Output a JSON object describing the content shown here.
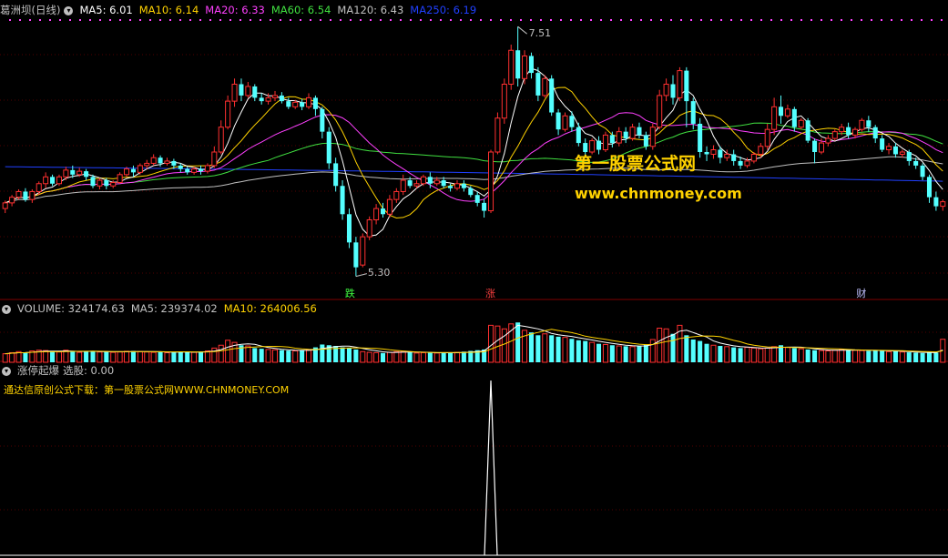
{
  "header": {
    "stock_title": "葛洲坝(日线)",
    "ma_items": [
      {
        "label": "MA5: 6.01",
        "color": "#ffffff"
      },
      {
        "label": "MA10: 6.14",
        "color": "#ffd200"
      },
      {
        "label": "MA20: 6.33",
        "color": "#ff40ff"
      },
      {
        "label": "MA60: 6.54",
        "color": "#40e040"
      },
      {
        "label": "MA120: 6.43",
        "color": "#c0c0c0"
      },
      {
        "label": "MA250: 6.19",
        "color": "#2040ff"
      }
    ]
  },
  "volume_header": {
    "items": [
      {
        "label": "VOLUME: 324174.63",
        "color": "#c0c0c0"
      },
      {
        "label": "MA5: 239374.02",
        "color": "#c0c0c0"
      },
      {
        "label": "MA10: 264006.56",
        "color": "#ffd200"
      }
    ]
  },
  "indicator_header": {
    "name": "涨停起爆",
    "select_label": "选股: 0.00",
    "note": "通达信原创公式下载：第一股票公式网WWW.CHNMONEY.COM"
  },
  "watermark": {
    "line1": "第一股票公式网",
    "line2": "www.chnmoney.com"
  },
  "annotations": {
    "high_label": "7.51",
    "low_label": "5.30",
    "tag_down": "跌",
    "tag_up": "涨",
    "tag_fin": "财"
  },
  "colors": {
    "up": "#ff3030",
    "down": "#54ffff",
    "ma5": "#ffffff",
    "ma10": "#ffd200",
    "ma20": "#ff40ff",
    "ma60": "#40e040",
    "ma120": "#c0c0c0",
    "ma250": "#2040ff",
    "grid": "#800000"
  },
  "chart_data": {
    "type": "candlestick",
    "price_ylim": [
      5.2,
      7.6
    ],
    "candles": [
      [
        5.9,
        5.95,
        5.86,
        5.97
      ],
      [
        5.95,
        6.0,
        5.92,
        6.02
      ],
      [
        6.0,
        6.05,
        5.98,
        6.07
      ],
      [
        6.05,
        5.98,
        5.96,
        6.08
      ],
      [
        5.98,
        6.05,
        5.95,
        6.07
      ],
      [
        6.05,
        6.12,
        6.02,
        6.14
      ],
      [
        6.12,
        6.18,
        6.08,
        6.22
      ],
      [
        6.18,
        6.12,
        6.1,
        6.2
      ],
      [
        6.12,
        6.18,
        6.1,
        6.2
      ],
      [
        6.18,
        6.24,
        6.15,
        6.27
      ],
      [
        6.24,
        6.2,
        6.17,
        6.28
      ],
      [
        6.2,
        6.23,
        6.18,
        6.26
      ],
      [
        6.23,
        6.18,
        6.15,
        6.25
      ],
      [
        6.18,
        6.1,
        6.08,
        6.2
      ],
      [
        6.1,
        6.15,
        6.07,
        6.17
      ],
      [
        6.15,
        6.1,
        6.07,
        6.17
      ],
      [
        6.1,
        6.13,
        6.08,
        6.15
      ],
      [
        6.13,
        6.2,
        6.12,
        6.22
      ],
      [
        6.2,
        6.25,
        6.18,
        6.27
      ],
      [
        6.25,
        6.22,
        6.18,
        6.28
      ],
      [
        6.22,
        6.28,
        6.2,
        6.3
      ],
      [
        6.28,
        6.3,
        6.25,
        6.33
      ],
      [
        6.3,
        6.35,
        6.28,
        6.38
      ],
      [
        6.35,
        6.3,
        6.27,
        6.37
      ],
      [
        6.3,
        6.32,
        6.28,
        6.35
      ],
      [
        6.32,
        6.28,
        6.25,
        6.34
      ],
      [
        6.28,
        6.25,
        6.22,
        6.3
      ],
      [
        6.25,
        6.22,
        6.2,
        6.27
      ],
      [
        6.22,
        6.25,
        6.2,
        6.27
      ],
      [
        6.25,
        6.23,
        6.2,
        6.28
      ],
      [
        6.23,
        6.28,
        6.21,
        6.3
      ],
      [
        6.28,
        6.4,
        6.26,
        6.45
      ],
      [
        6.4,
        6.62,
        6.38,
        6.68
      ],
      [
        6.62,
        6.85,
        6.6,
        6.9
      ],
      [
        6.85,
        7.0,
        6.8,
        7.05
      ],
      [
        7.0,
        6.9,
        6.85,
        7.05
      ],
      [
        6.9,
        6.98,
        6.88,
        7.02
      ],
      [
        6.98,
        6.88,
        6.85,
        7.0
      ],
      [
        6.88,
        6.85,
        6.82,
        6.92
      ],
      [
        6.85,
        6.88,
        6.82,
        6.92
      ],
      [
        6.88,
        6.9,
        6.85,
        6.94
      ],
      [
        6.9,
        6.85,
        6.83,
        6.93
      ],
      [
        6.85,
        6.8,
        6.78,
        6.88
      ],
      [
        6.8,
        6.84,
        6.78,
        6.86
      ],
      [
        6.84,
        6.8,
        6.77,
        6.87
      ],
      [
        6.8,
        6.88,
        6.78,
        6.92
      ],
      [
        6.88,
        6.78,
        6.72,
        6.9
      ],
      [
        6.78,
        6.58,
        6.52,
        6.8
      ],
      [
        6.58,
        6.3,
        6.25,
        6.62
      ],
      [
        6.3,
        6.1,
        6.05,
        6.35
      ],
      [
        6.1,
        5.85,
        5.8,
        6.15
      ],
      [
        5.85,
        5.6,
        5.55,
        5.9
      ],
      [
        5.6,
        5.38,
        5.3,
        5.65
      ],
      [
        5.4,
        5.65,
        5.38,
        5.68
      ],
      [
        5.65,
        5.8,
        5.62,
        5.83
      ],
      [
        5.8,
        5.9,
        5.76,
        5.94
      ],
      [
        5.9,
        5.85,
        5.82,
        5.95
      ],
      [
        5.85,
        5.98,
        5.82,
        6.02
      ],
      [
        5.98,
        6.05,
        5.95,
        6.08
      ],
      [
        6.05,
        6.15,
        6.02,
        6.2
      ],
      [
        6.15,
        6.1,
        6.08,
        6.18
      ],
      [
        6.1,
        6.12,
        6.08,
        6.15
      ],
      [
        6.12,
        6.18,
        6.1,
        6.2
      ],
      [
        6.18,
        6.12,
        6.08,
        6.22
      ],
      [
        6.12,
        6.15,
        6.1,
        6.18
      ],
      [
        6.15,
        6.1,
        6.08,
        6.18
      ],
      [
        6.1,
        6.08,
        6.05,
        6.12
      ],
      [
        6.08,
        6.12,
        6.06,
        6.15
      ],
      [
        6.12,
        6.08,
        6.05,
        6.15
      ],
      [
        6.08,
        6.02,
        6.0,
        6.1
      ],
      [
        6.02,
        5.95,
        5.92,
        6.05
      ],
      [
        5.95,
        5.88,
        5.82,
        5.98
      ],
      [
        5.88,
        6.4,
        5.86,
        6.42
      ],
      [
        6.4,
        6.7,
        6.38,
        6.75
      ],
      [
        6.7,
        7.0,
        6.65,
        7.05
      ],
      [
        7.0,
        7.3,
        6.95,
        7.35
      ],
      [
        7.3,
        7.05,
        6.98,
        7.51
      ],
      [
        7.05,
        7.25,
        7.0,
        7.3
      ],
      [
        7.25,
        7.1,
        7.05,
        7.28
      ],
      [
        7.1,
        6.9,
        6.85,
        7.15
      ],
      [
        6.9,
        7.05,
        6.88,
        7.08
      ],
      [
        7.05,
        6.75,
        6.72,
        7.08
      ],
      [
        6.75,
        6.6,
        6.55,
        6.78
      ],
      [
        6.6,
        6.72,
        6.58,
        6.75
      ],
      [
        6.72,
        6.62,
        6.58,
        6.76
      ],
      [
        6.62,
        6.48,
        6.45,
        6.66
      ],
      [
        6.48,
        6.4,
        6.35,
        6.52
      ],
      [
        6.4,
        6.5,
        6.38,
        6.52
      ],
      [
        6.5,
        6.42,
        6.38,
        6.54
      ],
      [
        6.42,
        6.55,
        6.4,
        6.58
      ],
      [
        6.55,
        6.48,
        6.44,
        6.58
      ],
      [
        6.48,
        6.58,
        6.45,
        6.62
      ],
      [
        6.58,
        6.52,
        6.48,
        6.62
      ],
      [
        6.52,
        6.62,
        6.5,
        6.65
      ],
      [
        6.62,
        6.55,
        6.52,
        6.66
      ],
      [
        6.55,
        6.45,
        6.42,
        6.58
      ],
      [
        6.45,
        6.62,
        6.42,
        6.65
      ],
      [
        6.62,
        6.9,
        6.6,
        6.95
      ],
      [
        6.9,
        7.0,
        6.85,
        7.05
      ],
      [
        7.0,
        6.88,
        6.82,
        7.08
      ],
      [
        6.88,
        7.12,
        6.85,
        7.15
      ],
      [
        7.12,
        6.85,
        6.62,
        7.15
      ],
      [
        6.85,
        6.65,
        6.6,
        6.88
      ],
      [
        6.65,
        6.4,
        6.35,
        6.7
      ],
      [
        6.4,
        6.38,
        6.32,
        6.45
      ],
      [
        6.38,
        6.42,
        6.34,
        6.46
      ],
      [
        6.42,
        6.35,
        6.3,
        6.45
      ],
      [
        6.35,
        6.38,
        6.32,
        6.42
      ],
      [
        6.38,
        6.32,
        6.28,
        6.42
      ],
      [
        6.32,
        6.28,
        6.25,
        6.36
      ],
      [
        6.28,
        6.32,
        6.26,
        6.35
      ],
      [
        6.32,
        6.38,
        6.3,
        6.4
      ],
      [
        6.38,
        6.45,
        6.35,
        6.48
      ],
      [
        6.45,
        6.6,
        6.42,
        6.65
      ],
      [
        6.6,
        6.8,
        6.55,
        6.88
      ],
      [
        6.8,
        6.72,
        6.65,
        6.9
      ],
      [
        6.72,
        6.78,
        6.7,
        6.82
      ],
      [
        6.78,
        6.62,
        6.58,
        6.8
      ],
      [
        6.62,
        6.68,
        6.6,
        6.7
      ],
      [
        6.68,
        6.5,
        6.48,
        6.7
      ],
      [
        6.5,
        6.4,
        6.3,
        6.52
      ],
      [
        6.4,
        6.48,
        6.38,
        6.52
      ],
      [
        6.48,
        6.52,
        6.45,
        6.55
      ],
      [
        6.52,
        6.58,
        6.5,
        6.6
      ],
      [
        6.58,
        6.62,
        6.55,
        6.65
      ],
      [
        6.62,
        6.55,
        6.52,
        6.66
      ],
      [
        6.55,
        6.6,
        6.52,
        6.62
      ],
      [
        6.6,
        6.68,
        6.58,
        6.7
      ],
      [
        6.68,
        6.62,
        6.58,
        6.72
      ],
      [
        6.62,
        6.52,
        6.48,
        6.64
      ],
      [
        6.52,
        6.42,
        6.4,
        6.55
      ],
      [
        6.42,
        6.45,
        6.38,
        6.48
      ],
      [
        6.45,
        6.38,
        6.35,
        6.48
      ],
      [
        6.38,
        6.4,
        6.35,
        6.42
      ],
      [
        6.4,
        6.32,
        6.28,
        6.42
      ],
      [
        6.32,
        6.28,
        6.25,
        6.35
      ],
      [
        6.28,
        6.18,
        6.15,
        6.3
      ],
      [
        6.18,
        6.0,
        5.95,
        6.2
      ],
      [
        6.0,
        5.92,
        5.88,
        6.05
      ],
      [
        5.92,
        5.96,
        5.88,
        5.98
      ]
    ],
    "volume_ylim": [
      0,
      640000
    ],
    "volumes": [
      120,
      135,
      150,
      140,
      160,
      170,
      165,
      150,
      145,
      170,
      155,
      140,
      150,
      160,
      145,
      150,
      140,
      145,
      155,
      160,
      150,
      145,
      140,
      150,
      135,
      140,
      150,
      145,
      140,
      150,
      160,
      200,
      240,
      310,
      280,
      240,
      230,
      200,
      190,
      180,
      175,
      170,
      165,
      160,
      170,
      175,
      210,
      250,
      240,
      230,
      210,
      200,
      180,
      150,
      140,
      135,
      130,
      140,
      150,
      155,
      140,
      130,
      135,
      140,
      130,
      135,
      130,
      140,
      150,
      160,
      170,
      180,
      520,
      510,
      470,
      540,
      560,
      450,
      420,
      380,
      400,
      380,
      360,
      350,
      330,
      310,
      300,
      280,
      260,
      250,
      240,
      230,
      225,
      220,
      230,
      250,
      320,
      480,
      470,
      400,
      520,
      380,
      320,
      300,
      260,
      240,
      230,
      220,
      210,
      200,
      210,
      200,
      190,
      200,
      220,
      240,
      210,
      200,
      190,
      180,
      170,
      165,
      160,
      170,
      180,
      175,
      170,
      165,
      160,
      170,
      160,
      150,
      155,
      145,
      140,
      135,
      130,
      140,
      135,
      324
    ],
    "volume_scale": 1000,
    "signal": [
      {
        "index": 72,
        "value": 1
      }
    ]
  }
}
